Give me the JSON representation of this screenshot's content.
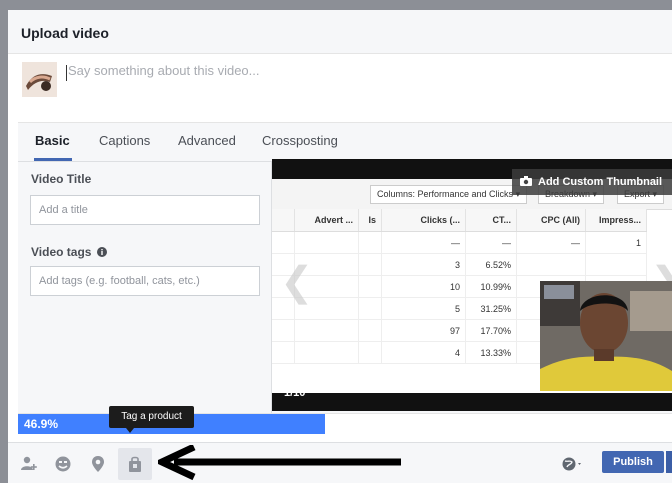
{
  "dialog": {
    "title": "Upload video"
  },
  "composer": {
    "placeholder": "Say something about this video..."
  },
  "tabs": [
    {
      "label": "Basic",
      "active": true
    },
    {
      "label": "Captions",
      "active": false
    },
    {
      "label": "Advanced",
      "active": false
    },
    {
      "label": "Crossposting",
      "active": false
    }
  ],
  "form": {
    "title_label": "Video Title",
    "title_placeholder": "Add a title",
    "tags_label": "Video tags",
    "tags_placeholder": "Add tags (e.g. football, cats, etc.)"
  },
  "preview": {
    "thumbnail_button": "Add Custom Thumbnail",
    "slide_counter": "1/10",
    "toolbar": {
      "columns": "Columns: Performance and Clicks",
      "breakdown": "Breakdown",
      "export": "Export"
    },
    "table_headers": [
      "Advert ...",
      "Is",
      "Clicks (...",
      "CT...",
      "CPC (All)",
      "Impress..."
    ],
    "table_rows": [
      [
        "",
        "",
        "—",
        "—",
        "—",
        "1"
      ],
      [
        "",
        "",
        "3",
        "6.52%",
        "",
        ""
      ],
      [
        "",
        "",
        "10",
        "10.99%",
        "",
        ""
      ],
      [
        "",
        "",
        "5",
        "31.25%",
        "",
        ""
      ],
      [
        "",
        "",
        "97",
        "17.70%",
        "",
        ""
      ],
      [
        "",
        "",
        "4",
        "13.33%",
        "",
        ""
      ]
    ]
  },
  "upload": {
    "progress_text": "46.9%",
    "progress": 0.469
  },
  "footer": {
    "tooltip": "Tag a product",
    "publish_label": "Publish",
    "icons": [
      "tag-friends-icon",
      "feeling-icon",
      "check-in-icon",
      "tag-product-icon",
      "audience-globe-icon"
    ]
  },
  "colors": {
    "accent": "#4267b2",
    "progress": "#4080ff",
    "annotation_arrow": "#000000"
  }
}
